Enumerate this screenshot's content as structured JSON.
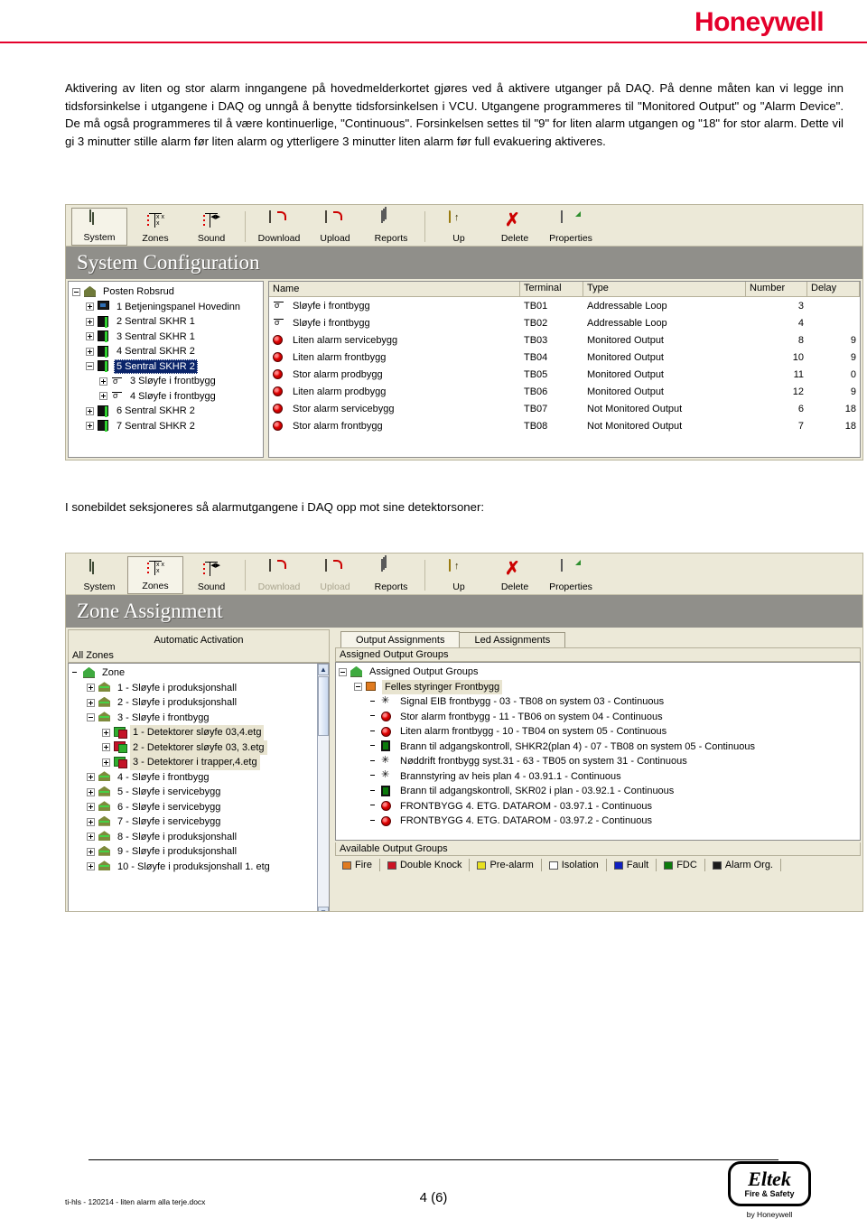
{
  "header": {
    "brand": "Honeywell",
    "brand_color": "#e4002b"
  },
  "paragraphs": {
    "intro": "Aktivering av liten og stor alarm inngangene på hovedmelderkortet gjøres ved å aktivere utganger på DAQ. På denne måten kan vi legge inn tidsforsinkelse i utgangene i DAQ og unngå å benytte tidsforsinkelsen i VCU. Utgangene programmeres til \"Monitored Output\" og \"Alarm Device\". De må også programmeres til å være kontinuerlige, \"Continuous\". Forsinkelsen settes til \"9\" for liten alarm utgangen og \"18\" for stor alarm. Dette vil gi 3 minutter stille alarm før liten alarm og ytterligere 3 minutter liten alarm før full evakuering aktiveres.",
    "mid": "I sonebildet seksjoneres så alarmutgangene i DAQ opp mot sine detektorsoner:"
  },
  "toolbar": {
    "buttons": [
      {
        "label": "System",
        "icon": "system-icon",
        "state": "selected"
      },
      {
        "label": "Zones",
        "icon": "zones-icon",
        "state": "normal"
      },
      {
        "label": "Sound",
        "icon": "sound-icon",
        "state": "normal"
      },
      {
        "label": "Download",
        "icon": "download-icon",
        "state": "normal"
      },
      {
        "label": "Upload",
        "icon": "upload-icon",
        "state": "normal"
      },
      {
        "label": "Reports",
        "icon": "reports-icon",
        "state": "normal"
      },
      {
        "label": "Up",
        "icon": "up-icon",
        "state": "normal"
      },
      {
        "label": "Delete",
        "icon": "delete-icon",
        "state": "normal"
      },
      {
        "label": "Properties",
        "icon": "properties-icon",
        "state": "normal"
      }
    ],
    "buttons2": [
      {
        "label": "System",
        "icon": "system-icon",
        "state": "normal"
      },
      {
        "label": "Zones",
        "icon": "zones-icon",
        "state": "selected"
      },
      {
        "label": "Sound",
        "icon": "sound-icon",
        "state": "normal"
      },
      {
        "label": "Download",
        "icon": "download-icon",
        "state": "disabled"
      },
      {
        "label": "Upload",
        "icon": "upload-icon",
        "state": "disabled"
      },
      {
        "label": "Reports",
        "icon": "reports-icon",
        "state": "normal"
      },
      {
        "label": "Up",
        "icon": "up-icon",
        "state": "normal"
      },
      {
        "label": "Delete",
        "icon": "delete-icon",
        "state": "normal"
      },
      {
        "label": "Properties",
        "icon": "properties-icon",
        "state": "normal"
      }
    ]
  },
  "system_config": {
    "banner": "System Configuration",
    "tree": [
      {
        "label": "Posten Robsrud",
        "indent": 0,
        "toggle": "minus",
        "icon": "house-icon",
        "selected": false
      },
      {
        "label": "1 Betjeningspanel Hovedinn",
        "indent": 1,
        "toggle": "plus",
        "icon": "panel-icon",
        "selected": false
      },
      {
        "label": "2 Sentral SKHR 1",
        "indent": 1,
        "toggle": "plus",
        "icon": "sentral-icon",
        "selected": false
      },
      {
        "label": "3 Sentral SKHR 1",
        "indent": 1,
        "toggle": "plus",
        "icon": "sentral-icon",
        "selected": false
      },
      {
        "label": "4 Sentral SKHR 2",
        "indent": 1,
        "toggle": "plus",
        "icon": "sentral-icon",
        "selected": false
      },
      {
        "label": "5 Sentral SKHR 2",
        "indent": 1,
        "toggle": "minus",
        "icon": "sentral-icon",
        "selected": true
      },
      {
        "label": "3 Sløyfe i frontbygg",
        "indent": 2,
        "toggle": "plus",
        "icon": "loop-icon",
        "selected": false
      },
      {
        "label": "4 Sløyfe i frontbygg",
        "indent": 2,
        "toggle": "plus",
        "icon": "loop-icon",
        "selected": false
      },
      {
        "label": "6 Sentral SKHR 2",
        "indent": 1,
        "toggle": "plus",
        "icon": "sentral-icon",
        "selected": false
      },
      {
        "label": "7 Sentral SHKR 2",
        "indent": 1,
        "toggle": "plus",
        "icon": "sentral-icon",
        "selected": false
      }
    ],
    "columns": [
      "Name",
      "Terminal",
      "Type",
      "Number",
      "Delay"
    ],
    "rows": [
      {
        "icon": "loop-icon",
        "name": "Sløyfe i frontbygg",
        "terminal": "TB01",
        "type": "Addressable  Loop",
        "number": "3",
        "delay": ""
      },
      {
        "icon": "loop-icon",
        "name": "Sløyfe i frontbygg",
        "terminal": "TB02",
        "type": "Addressable  Loop",
        "number": "4",
        "delay": ""
      },
      {
        "icon": "red-icon",
        "name": "Liten alarm servicebygg",
        "terminal": "TB03",
        "type": "Monitored Output",
        "number": "8",
        "delay": "9"
      },
      {
        "icon": "red-icon",
        "name": "Liten alarm frontbygg",
        "terminal": "TB04",
        "type": "Monitored Output",
        "number": "10",
        "delay": "9"
      },
      {
        "icon": "red-icon",
        "name": "Stor alarm prodbygg",
        "terminal": "TB05",
        "type": "Monitored Output",
        "number": "11",
        "delay": "0"
      },
      {
        "icon": "red-icon",
        "name": "Liten alarm prodbygg",
        "terminal": "TB06",
        "type": "Monitored Output",
        "number": "12",
        "delay": "9"
      },
      {
        "icon": "red-icon",
        "name": "Stor alarm servicebygg",
        "terminal": "TB07",
        "type": "Not Monitored Output",
        "number": "6",
        "delay": "18"
      },
      {
        "icon": "red-icon",
        "name": "Stor alarm frontbygg",
        "terminal": "TB08",
        "type": "Not Monitored Output",
        "number": "7",
        "delay": "18"
      }
    ]
  },
  "zone_assignment": {
    "banner": "Zone Assignment",
    "left_panel_title": "Automatic Activation",
    "left_list_header": "All Zones",
    "tabs": [
      {
        "label": "Output Assignments",
        "active": true
      },
      {
        "label": "Led Assignments",
        "active": false
      }
    ],
    "assigned_header": "Assigned Output Groups",
    "zone_tree": [
      {
        "label": "Zone",
        "indent": 0,
        "toggle": "none",
        "icon": "house-green-icon",
        "hl": false
      },
      {
        "label": "1  -  Sløyfe i produksjonshall",
        "indent": 1,
        "toggle": "plus",
        "icon": "zone-icon",
        "hl": false
      },
      {
        "label": "2  -  Sløyfe i produksjonshall",
        "indent": 1,
        "toggle": "plus",
        "icon": "zone-icon",
        "hl": false
      },
      {
        "label": "3  -  Sløyfe i frontbygg",
        "indent": 1,
        "toggle": "minus",
        "icon": "zone-icon",
        "hl": false
      },
      {
        "label": "1  -  Detektorer sløyfe 03,4.etg",
        "indent": 2,
        "toggle": "plus",
        "icon": "detector-icon",
        "hl": true
      },
      {
        "label": "2  -  Detektorer sløyfe 03, 3.etg",
        "indent": 2,
        "toggle": "plus",
        "icon": "detector-red-icon",
        "hl": true
      },
      {
        "label": "3  -  Detektorer i trapper,4.etg",
        "indent": 2,
        "toggle": "plus",
        "icon": "detector-icon",
        "hl": true
      },
      {
        "label": "4  -  Sløyfe i frontbygg",
        "indent": 1,
        "toggle": "plus",
        "icon": "zone-icon",
        "hl": false
      },
      {
        "label": "5  -  Sløyfe i servicebygg",
        "indent": 1,
        "toggle": "plus",
        "icon": "zone-icon",
        "hl": false
      },
      {
        "label": "6  -  Sløyfe i servicebygg",
        "indent": 1,
        "toggle": "plus",
        "icon": "zone-icon",
        "hl": false
      },
      {
        "label": "7  -  Sløyfe i servicebygg",
        "indent": 1,
        "toggle": "plus",
        "icon": "zone-icon",
        "hl": false
      },
      {
        "label": "8  -  Sløyfe i produksjonshall",
        "indent": 1,
        "toggle": "plus",
        "icon": "zone-icon",
        "hl": false
      },
      {
        "label": "9  -  Sløyfe i produksjonshall",
        "indent": 1,
        "toggle": "plus",
        "icon": "zone-icon",
        "hl": false
      },
      {
        "label": "10  -  Sløyfe i produksjonshall 1. etg",
        "indent": 1,
        "toggle": "plus",
        "icon": "zone-icon",
        "hl": false
      }
    ],
    "output_tree": [
      {
        "label": "Assigned Output Groups",
        "indent": 0,
        "toggle": "minus",
        "icon": "house-green-icon",
        "hl": false
      },
      {
        "label": "Felles styringer Frontbygg",
        "indent": 1,
        "toggle": "minus",
        "icon": "group-icon",
        "hl": true
      },
      {
        "label": "Signal EIB frontbygg - 03 - TB08 on system 03 - Continuous",
        "indent": 2,
        "toggle": "none",
        "icon": "star-icon",
        "hl": false
      },
      {
        "label": "Stor alarm frontbygg - 11 - TB06 on system 04 - Continuous",
        "indent": 2,
        "toggle": "none",
        "icon": "red-icon",
        "hl": false
      },
      {
        "label": "Liten alarm frontbygg - 10 - TB04 on system 05 - Continuous",
        "indent": 2,
        "toggle": "none",
        "icon": "red-icon",
        "hl": false
      },
      {
        "label": "Brann til adgangskontroll, SHKR2(plan 4) - 07 - TB08 on system 05 - Continuous",
        "indent": 2,
        "toggle": "none",
        "icon": "door-icon",
        "hl": false
      },
      {
        "label": "Nøddrift frontbygg syst.31 - 63 - TB05 on system 31 - Continuous",
        "indent": 2,
        "toggle": "none",
        "icon": "star-icon",
        "hl": false
      },
      {
        "label": "Brannstyring av heis plan 4 - 03.91.1 - Continuous",
        "indent": 2,
        "toggle": "none",
        "icon": "star-icon",
        "hl": false
      },
      {
        "label": "Brann til adgangskontroll, SKR02 i plan - 03.92.1 - Continuous",
        "indent": 2,
        "toggle": "none",
        "icon": "door-icon",
        "hl": false
      },
      {
        "label": "FRONTBYGG 4. ETG. DATAROM - 03.97.1 - Continuous",
        "indent": 2,
        "toggle": "none",
        "icon": "red-icon",
        "hl": false
      },
      {
        "label": "FRONTBYGG 4. ETG. DATAROM - 03.97.2 - Continuous",
        "indent": 2,
        "toggle": "none",
        "icon": "red-icon",
        "hl": false
      }
    ],
    "available_header": "Available Output Groups",
    "available_tabs": [
      {
        "label": "Fire",
        "color": "#e07b20"
      },
      {
        "label": "Double Knock",
        "color": "#cc1324"
      },
      {
        "label": "Pre-alarm",
        "color": "#e8e020"
      },
      {
        "label": "Isolation",
        "color": "#ffffff"
      },
      {
        "label": "Fault",
        "color": "#1020c0"
      },
      {
        "label": "FDC",
        "color": "#0b7a0b"
      },
      {
        "label": "Alarm Org.",
        "color": "#1b1b1b"
      }
    ]
  },
  "footer": {
    "file": "ti-hls - 120214 - liten alarm alla terje.docx",
    "page": "4 (6)",
    "logo_name": "Eltek",
    "logo_sub": "Fire & Safety",
    "logo_by": "by Honeywell"
  }
}
